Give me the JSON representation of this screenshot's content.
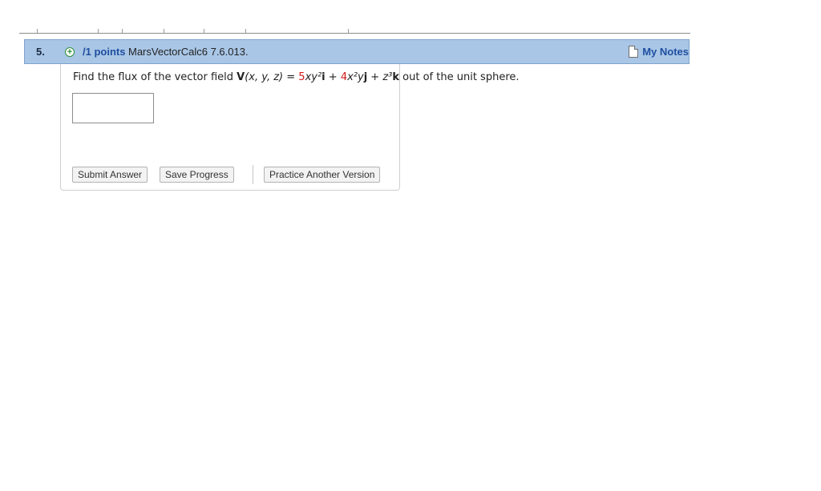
{
  "question": {
    "number": "5.",
    "points": "/1 points",
    "source": "MarsVectorCalc6 7.6.013.",
    "my_notes": "My Notes",
    "text": {
      "prefix": "Find the flux of the vector field ",
      "field_name": "V",
      "args": "(x, y, z)",
      "equals": " = ",
      "coef1": "5",
      "term1": "xy²",
      "vec_i": "i",
      "plus1": " + ",
      "coef2": "4",
      "term2": "x²y",
      "vec_j": "j",
      "plus2": " + ",
      "term3": "z³",
      "vec_k": "k",
      "suffix": " out of the unit sphere."
    },
    "answer_value": ""
  },
  "buttons": {
    "submit": "Submit Answer",
    "save": "Save Progress",
    "practice": "Practice Another Version"
  },
  "colors": {
    "header_bg": "#a9c6e6",
    "link_blue": "#1f4fa0",
    "coef_red": "#d11a1a"
  },
  "icons": {
    "expand": "plus-circle-icon",
    "notes": "note-icon"
  }
}
